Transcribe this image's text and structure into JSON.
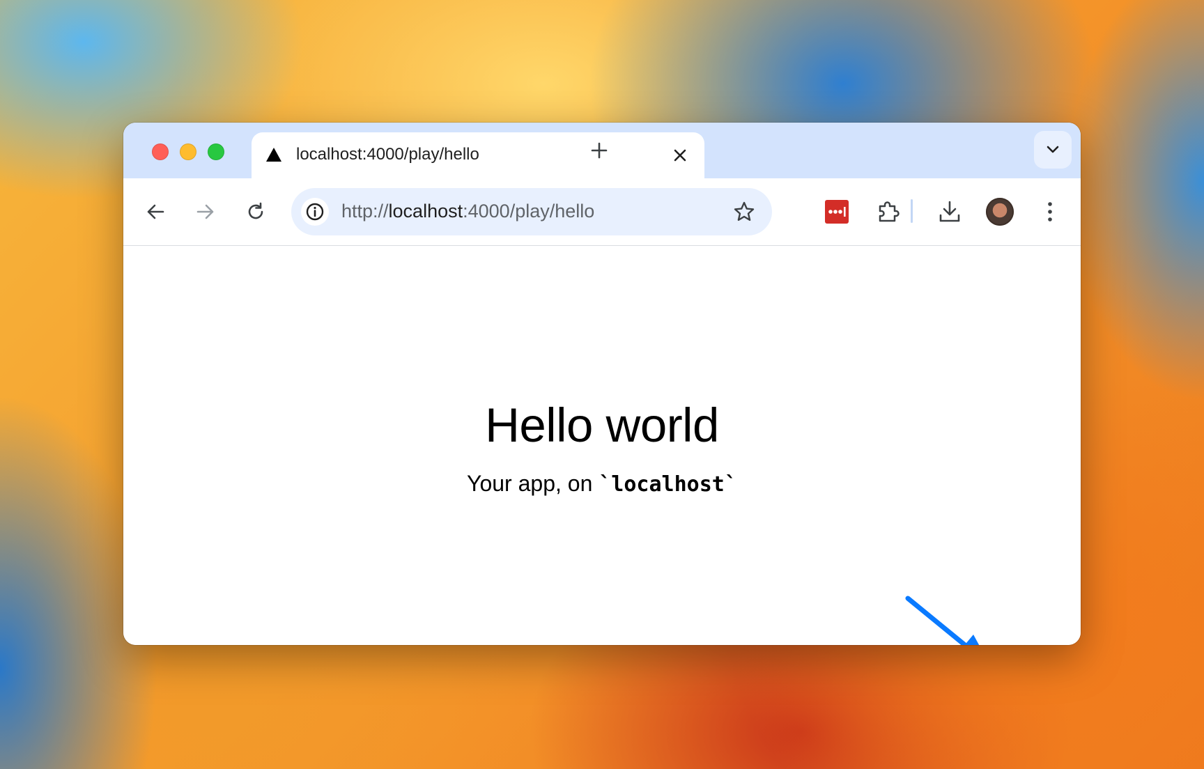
{
  "browser": {
    "tab": {
      "title": "localhost:4000/play/hello",
      "favicon": "triangle-icon"
    },
    "address_bar": {
      "scheme": "http://",
      "host": "localhost",
      "rest": ":4000/play/hello"
    },
    "toolbar_icons": [
      "back-icon",
      "forward-icon",
      "reload-icon",
      "site-info-icon",
      "bookmark-star-icon",
      "lastpass-icon",
      "extensions-icon",
      "downloads-icon",
      "profile-avatar",
      "menu-kebab-icon"
    ]
  },
  "page": {
    "heading": "Hello world",
    "subtitle_prefix": "Your app, on ",
    "subtitle_code": "`localhost`"
  },
  "colors": {
    "tabstrip": "#d3e3fd",
    "omnibox": "#e8f0fe",
    "lastpass_red": "#d32d27",
    "arrow_blue": "#0a7aff"
  }
}
